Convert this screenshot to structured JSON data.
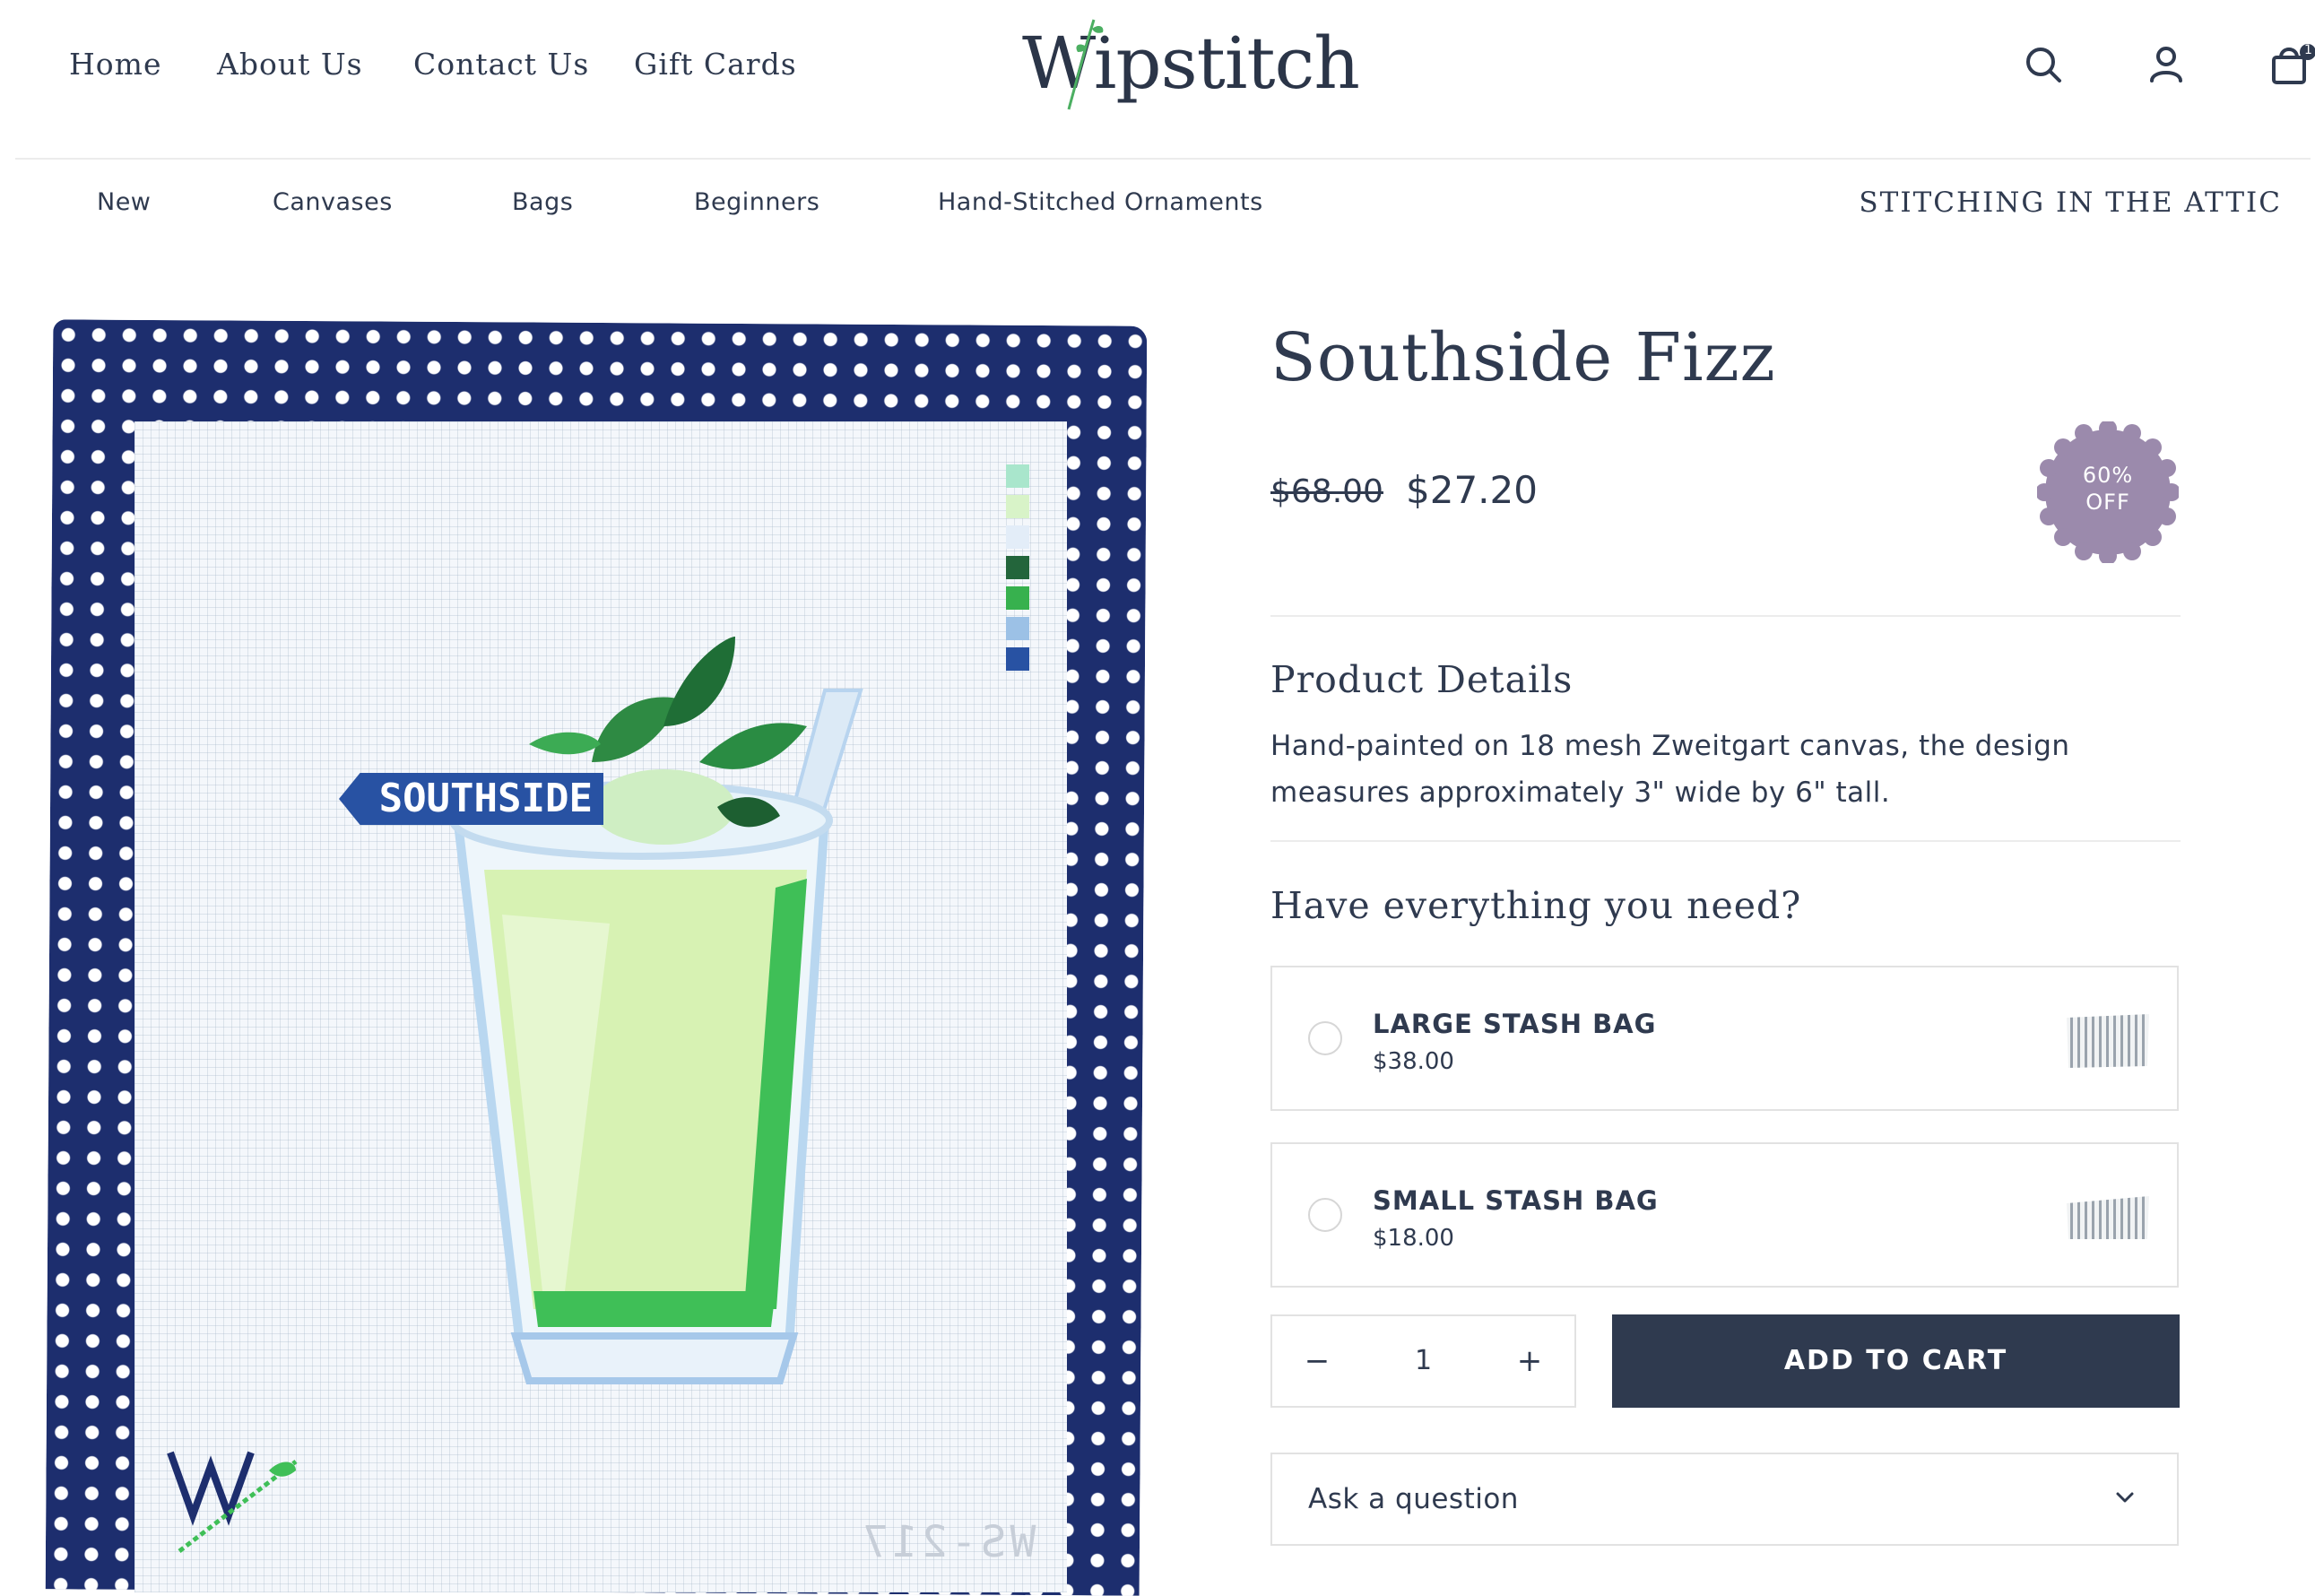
{
  "header": {
    "nav": [
      "Home",
      "About Us",
      "Contact Us",
      "Gift Cards"
    ],
    "logo_text": "Wipstitch",
    "icons": [
      "search-icon",
      "account-icon",
      "cart-icon"
    ],
    "cart_count": "1"
  },
  "subnav": {
    "items": [
      "New",
      "Canvases",
      "Bags",
      "Beginners",
      "Hand-Stitched Ornaments"
    ],
    "right_label": "STITCHING IN THE ATTIC"
  },
  "product": {
    "image_label": "SOUTHSIDE",
    "image_code": "WS-217",
    "title": "Southside Fizz",
    "compare_price": "$68.00",
    "price": "$27.20",
    "badge_line1": "60%",
    "badge_line2": "OFF",
    "details_heading": "Product Details",
    "details_text": "Hand-painted on 18 mesh Zweitgart canvas, the design measures approximately 3\" wide by 6\" tall.",
    "upsell_heading": "Have everything you need?",
    "addons": [
      {
        "name": "LARGE STASH BAG",
        "price": "$38.00"
      },
      {
        "name": "SMALL STASH BAG",
        "price": "$18.00"
      }
    ],
    "quantity": "1",
    "qty_minus": "−",
    "qty_plus": "+",
    "add_to_cart": "ADD TO CART",
    "ask_question": "Ask a question"
  },
  "colors": {
    "text": "#2f3a4f",
    "button": "#2f3a4f",
    "badge": "#9b8aac",
    "frame_navy": "#1d2e6e"
  }
}
